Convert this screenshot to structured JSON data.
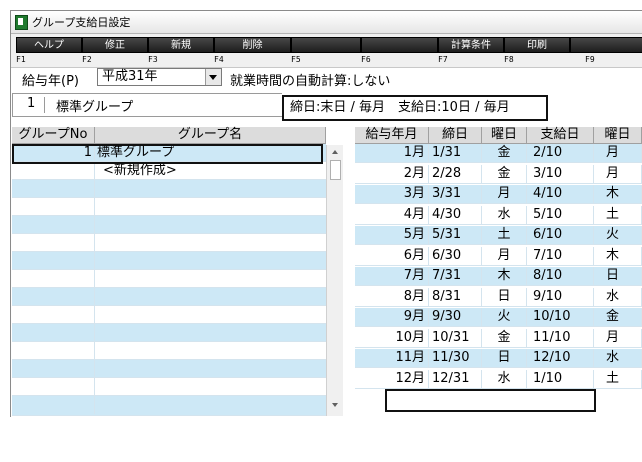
{
  "window": {
    "title": "グループ支給日設定"
  },
  "toolbar": {
    "buttons": [
      {
        "label": "ヘルプ",
        "key": "F1"
      },
      {
        "label": "修正",
        "key": "F2"
      },
      {
        "label": "新規",
        "key": "F3"
      },
      {
        "label": "削除",
        "key": "F4"
      },
      {
        "label": "",
        "key": "F5"
      },
      {
        "label": "",
        "key": "F6"
      },
      {
        "label": "計算条件",
        "key": "F7"
      },
      {
        "label": "印刷",
        "key": "F8"
      },
      {
        "label": "",
        "key": "F9"
      }
    ]
  },
  "filters": {
    "year_label": "給与年(P)",
    "year_value": "平成31年",
    "auto_calc_text": "就業時間の自動計算:しない"
  },
  "group_box": {
    "number": "1",
    "name": "標準グループ"
  },
  "info": {
    "text": "締日:末日 / 毎月　支給日:10日 / 毎月"
  },
  "group_table": {
    "headers": [
      "グループNo",
      "グループ名"
    ],
    "rows": [
      {
        "no": "1",
        "name": "標準グループ"
      },
      {
        "no": "",
        "name": "<新規作成>"
      }
    ]
  },
  "month_table": {
    "headers": [
      "給与年月",
      "締日",
      "曜日",
      "支給日",
      "曜日"
    ],
    "rows": [
      {
        "month": "1月",
        "close": "1/31",
        "close_dow": "金",
        "pay": "2/10",
        "pay_dow": "月"
      },
      {
        "month": "2月",
        "close": "2/28",
        "close_dow": "金",
        "pay": "3/10",
        "pay_dow": "月"
      },
      {
        "month": "3月",
        "close": "3/31",
        "close_dow": "月",
        "pay": "4/10",
        "pay_dow": "木"
      },
      {
        "month": "4月",
        "close": "4/30",
        "close_dow": "水",
        "pay": "5/10",
        "pay_dow": "土"
      },
      {
        "month": "5月",
        "close": "5/31",
        "close_dow": "土",
        "pay": "6/10",
        "pay_dow": "火"
      },
      {
        "month": "6月",
        "close": "6/30",
        "close_dow": "月",
        "pay": "7/10",
        "pay_dow": "木"
      },
      {
        "month": "7月",
        "close": "7/31",
        "close_dow": "木",
        "pay": "8/10",
        "pay_dow": "日"
      },
      {
        "month": "8月",
        "close": "8/31",
        "close_dow": "日",
        "pay": "9/10",
        "pay_dow": "水"
      },
      {
        "month": "9月",
        "close": "9/30",
        "close_dow": "火",
        "pay": "10/10",
        "pay_dow": "金"
      },
      {
        "month": "10月",
        "close": "10/31",
        "close_dow": "金",
        "pay": "11/10",
        "pay_dow": "月"
      },
      {
        "month": "11月",
        "close": "11/30",
        "close_dow": "日",
        "pay": "12/10",
        "pay_dow": "水"
      },
      {
        "month": "12月",
        "close": "12/31",
        "close_dow": "水",
        "pay": "1/10",
        "pay_dow": "土"
      }
    ]
  },
  "colors": {
    "row_blue": "#cde8f6",
    "toolbar_button": "#2a2a2a",
    "highlight_border": "#111111"
  }
}
